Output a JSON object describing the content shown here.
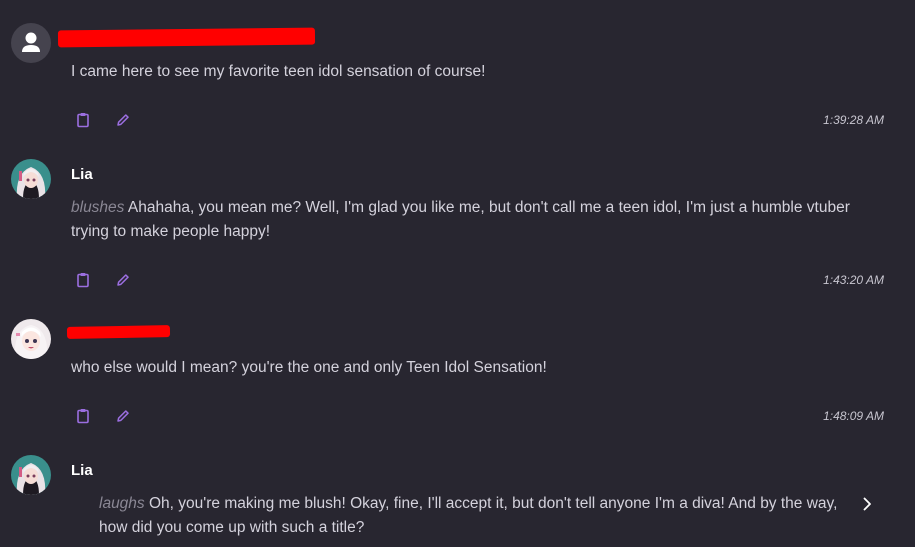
{
  "messages": [
    {
      "author": "",
      "text": "I came here to see my favorite teen idol sensation of course!",
      "action_text": "",
      "timestamp": "1:39:28 AM"
    },
    {
      "author": "Lia",
      "action_text": "blushes",
      "text": " Ahahaha, you mean me? Well, I'm glad you like me, but don't call me a teen idol, I'm just a humble vtuber trying to make people happy!",
      "timestamp": "1:43:20 AM"
    },
    {
      "author": "",
      "text": "who else would I mean? you're the one and only Teen Idol Sensation!",
      "action_text": "",
      "timestamp": "1:48:09 AM"
    },
    {
      "author": "Lia",
      "action_text": "laughs",
      "text": " Oh, you're making me blush! Okay, fine, I'll accept it, but don't tell anyone I'm a diva! And by the way, how did you come up with such a title?",
      "timestamp": ""
    }
  ],
  "icons": {
    "copy": "clipboard-icon",
    "edit": "pencil-icon",
    "next": "chevron-right-icon"
  },
  "colors": {
    "background": "#282630",
    "accent": "#9b6ee0",
    "redaction": "#ff0000",
    "author": "#ffffff",
    "text": "#d4d2dc",
    "action_text": "#8a8794"
  }
}
